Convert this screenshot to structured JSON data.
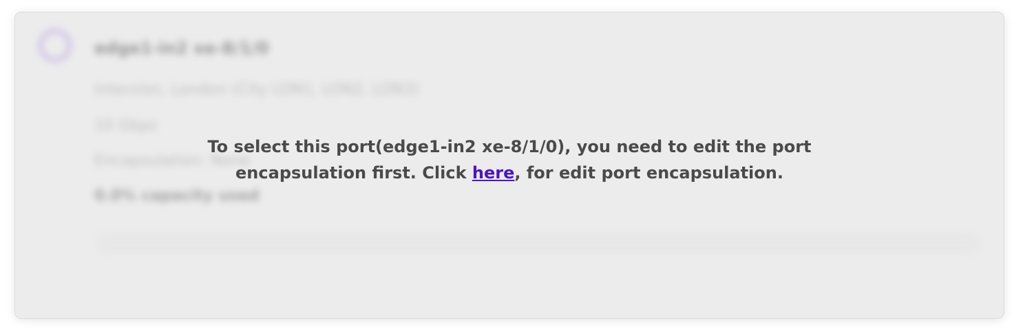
{
  "port_card": {
    "name": "edge1-in2 xe-8/1/0",
    "location": "Interxion, London (City LON1, LON2, LON3)",
    "speed": "10 Gbps",
    "encapsulation": "Encapsulation: None",
    "capacity_text": "0.0% capacity used",
    "capacity_used": 0.0,
    "colors": {
      "status_ring": "#b79de6",
      "link": "#4b15c4",
      "card_background": "#ececec"
    }
  },
  "overlay": {
    "line1": "To select this port(edge1-in2 xe-8/1/0), you need to edit the port",
    "line2_before": "encapsulation first. Click ",
    "link_text": "here",
    "line2_after": ", for edit port encapsulation."
  }
}
